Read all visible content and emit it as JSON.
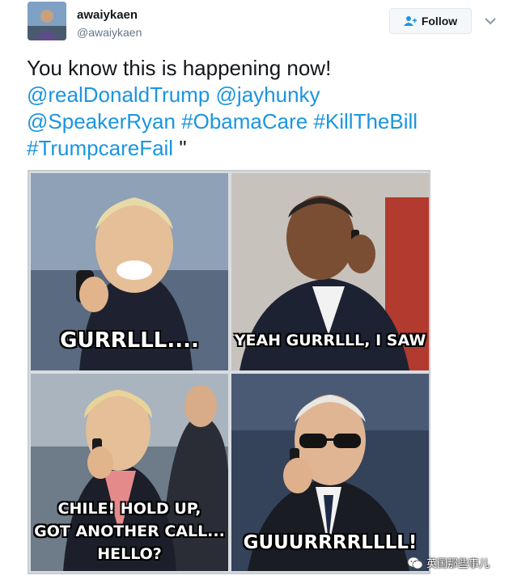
{
  "user": {
    "name": "awaiykaen",
    "handle": "@awaiykaen"
  },
  "follow_button": {
    "label": "Follow",
    "icon": "add-user-icon"
  },
  "menu_icon": "chevron-down-icon",
  "tweet": {
    "line1": "You know this is happening now!",
    "mentions_line2": "@realDonaldTrump @jayhunky",
    "mentions_line3": "@SpeakerRyan #ObamaCare #KillTheBill",
    "hashtag_line4": "#TrumpcareFail",
    "trailing": " \""
  },
  "meme": {
    "panels": [
      {
        "caption": "GURRLLL...."
      },
      {
        "caption": "YEAH GURRLLL, I SAW"
      },
      {
        "caption_lines": [
          "CHILE! HOLD UP,",
          "GOT ANOTHER CALL...",
          "HELLO?"
        ]
      },
      {
        "caption": "GUUURRRRLLLL!"
      }
    ]
  },
  "watermark": {
    "text": "英国那些事儿",
    "icon": "wechat-icon"
  },
  "colors": {
    "link": "#1b95e0",
    "text": "#14171a",
    "muted": "#657786"
  }
}
